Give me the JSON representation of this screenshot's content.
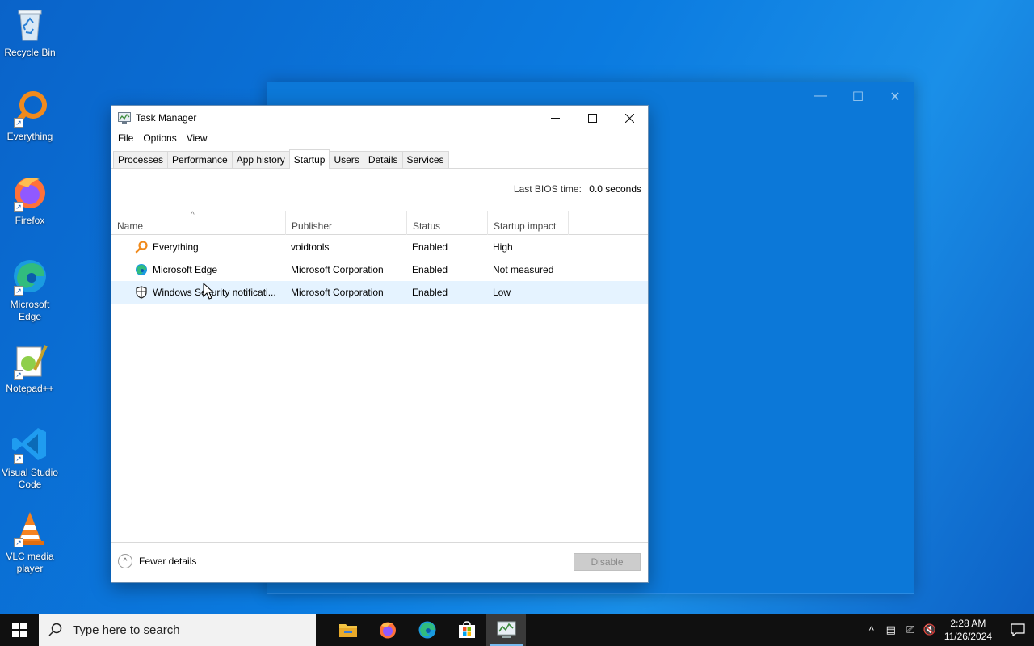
{
  "desktop": {
    "icons": [
      {
        "label": "Recycle Bin"
      },
      {
        "label": "Everything"
      },
      {
        "label": "Firefox"
      },
      {
        "label": "Microsoft Edge"
      },
      {
        "label": "Notepad++"
      },
      {
        "label": "Visual Studio Code"
      },
      {
        "label": "VLC media player"
      }
    ]
  },
  "task_manager": {
    "title": "Task Manager",
    "menu": [
      "File",
      "Options",
      "View"
    ],
    "tabs": [
      "Processes",
      "Performance",
      "App history",
      "Startup",
      "Users",
      "Details",
      "Services"
    ],
    "active_tab": "Startup",
    "bios_label": "Last BIOS time:",
    "bios_value": "0.0 seconds",
    "columns": [
      "Name",
      "Publisher",
      "Status",
      "Startup impact"
    ],
    "rows": [
      {
        "name": "Everything",
        "publisher": "voidtools",
        "status": "Enabled",
        "impact": "High",
        "icon": "everything-icon"
      },
      {
        "name": "Microsoft Edge",
        "publisher": "Microsoft Corporation",
        "status": "Enabled",
        "impact": "Not measured",
        "icon": "edge-icon"
      },
      {
        "name": "Windows Security notificati...",
        "publisher": "Microsoft Corporation",
        "status": "Enabled",
        "impact": "Low",
        "icon": "shield-icon"
      }
    ],
    "fewer_details": "Fewer details",
    "disable_button": "Disable"
  },
  "taskbar": {
    "search_placeholder": "Type here to search",
    "time": "2:28 AM",
    "date": "11/26/2024"
  },
  "colors": {
    "desktop": "#0b7be0",
    "taskbar": "#101010",
    "hover_row": "#e5f3ff"
  }
}
